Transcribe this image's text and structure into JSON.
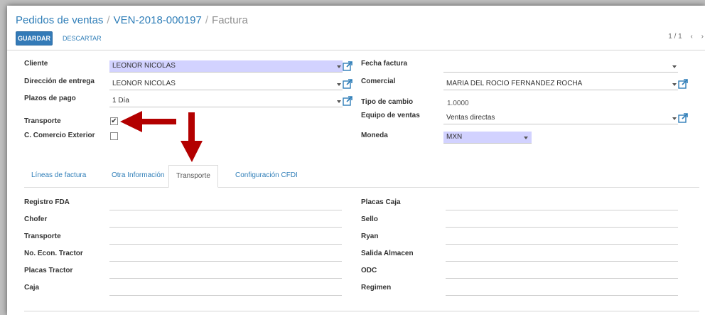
{
  "breadcrumb": {
    "root": "Pedidos de ventas",
    "record": "VEN-2018-000197",
    "current": "Factura",
    "separator": "/"
  },
  "toolbar": {
    "save_label": "GUARDAR",
    "discard_label": "DESCARTAR"
  },
  "pager": {
    "value": "1 / 1",
    "prev": "‹",
    "next": "›"
  },
  "form": {
    "left": [
      {
        "label": "Cliente",
        "value": "LEONOR NICOLAS"
      },
      {
        "label": "Dirección de entrega",
        "value": "LEONOR NICOLAS"
      },
      {
        "label": "Plazos de pago",
        "value": "1 Día"
      },
      {
        "label": "Transporte",
        "checked": true
      },
      {
        "label": "C. Comercio Exterior",
        "checked": false
      }
    ],
    "right": [
      {
        "label": "Fecha factura",
        "value": ""
      },
      {
        "label": "Comercial",
        "value": "MARIA DEL ROCIO FERNANDEZ ROCHA"
      },
      {
        "label": "Tipo de cambio",
        "value": "1.0000"
      },
      {
        "label": "Equipo de ventas",
        "value": "Ventas directas"
      },
      {
        "label": "Moneda",
        "value": "MXN"
      }
    ],
    "check_mark": "✔"
  },
  "tabs": [
    {
      "label": "Líneas de factura"
    },
    {
      "label": "Otra Información"
    },
    {
      "label": "Transporte"
    },
    {
      "label": "Configuración CFDI"
    }
  ],
  "transport": {
    "left": [
      "Registro FDA",
      "Chofer",
      "Transporte",
      "No. Econ. Tractor",
      "Placas Tractor",
      "Caja"
    ],
    "right": [
      "Placas Caja",
      "Sello",
      "Ryan",
      "Salida Almacen",
      "ODC",
      "Regimen"
    ]
  },
  "colors": {
    "accent": "#337ab7",
    "link": "#2f7eb8",
    "required_bg": "#d2d2ff",
    "annotation_arrow": "#b30000"
  },
  "icons": [
    "external-link-icon",
    "dropdown-caret-icon",
    "checkbox-checked-icon",
    "red-arrow-left-icon",
    "red-arrow-down-icon"
  ]
}
